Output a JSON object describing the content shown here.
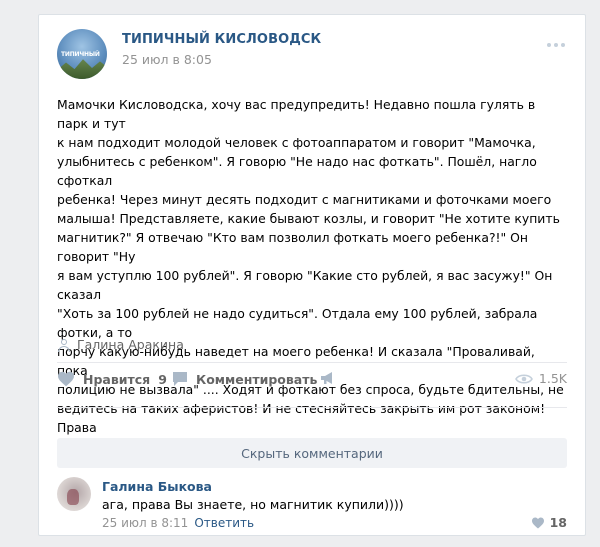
{
  "post": {
    "author": "ТИПИЧНЫЙ КИСЛОВОДСК",
    "avatar_label": "ТИПИЧНЫЙ",
    "date": "25 июл в 8:05",
    "text": "Мамочки Кисловодска, хочу вас предупредить! Недавно пошла гулять в парк и тут\nк нам подходит молодой человек с фотоаппаратом и говорит \"Мамочка,\nулыбнитесь с ребенком\". Я говорю \"Не надо нас фоткать\". Пошёл, нагло сфоткал\nребенка! Через минут десять подходит с магнитиками и фоточками моего\nмалыша! Представляете, какие бывают козлы, и говорит \"Не хотите купить\nмагнитик?\" Я отвечаю \"Кто вам позволил фоткать моего ребенка?!\" Он говорит \"Ну\nя вам уступлю 100 рублей\". Я говорю \"Какие сто рублей, я вас засужу!\" Он сказал\n\"Хоть за 100 рублей не надо судиться\". Отдала ему 100 рублей, забрала фотки, а то\nпорчу какую-нибудь наведет на моего ребенка! И сказала \"Проваливай, пока\nполицию не вызвала\" .... Ходят и фоткают без спроса, будьте бдительны, не\nведитесь на таких аферистов! И не стесняйтесь закрыть им рот законом! Права\nмы знаем!",
    "signer": "Галина Аракина"
  },
  "actions": {
    "like_label": "Нравится",
    "like_count": "9",
    "comment_label": "Комментировать",
    "views": "1.5K"
  },
  "hide_comments_label": "Скрыть комментарии",
  "comment": {
    "author": "Галина Быкова",
    "text": "ага, права Вы знаете, но магнитик купили))))",
    "date": "25 июл в 8:11",
    "reply_label": "Ответить",
    "likes": "18"
  },
  "icons": {
    "more": "more-icon",
    "person": "person-icon",
    "heart": "heart-icon",
    "comment": "comment-icon",
    "share": "share-icon",
    "views": "eye-icon"
  },
  "colors": {
    "link": "#2a5885",
    "muted": "#939393",
    "icon": "#aab8c7",
    "background": "#edeef0"
  }
}
